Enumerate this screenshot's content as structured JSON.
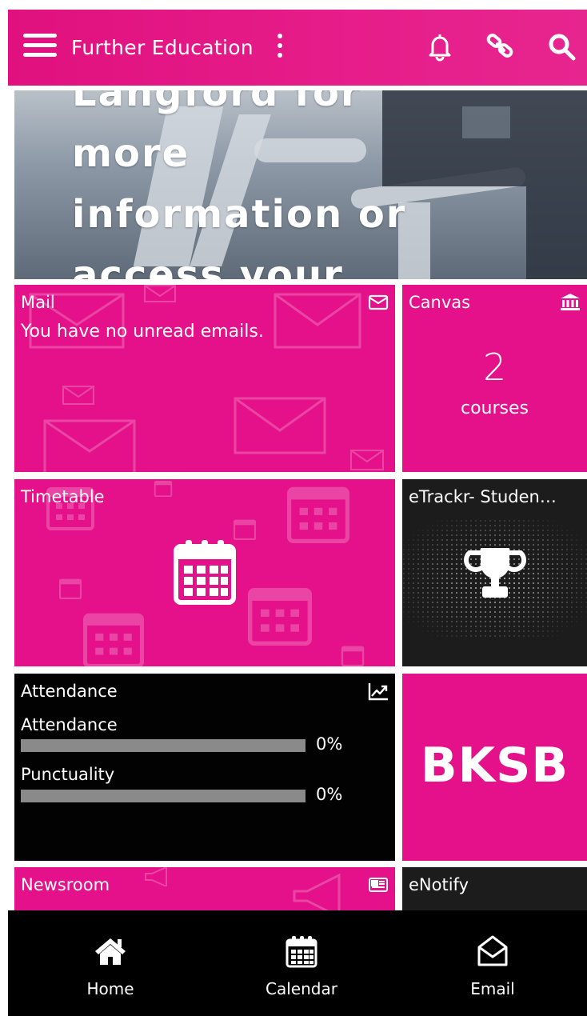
{
  "header": {
    "title": "Further Education",
    "icons": [
      "menu-icon",
      "more-vertical-icon",
      "bell-icon",
      "link-icon",
      "search-icon"
    ]
  },
  "banner": {
    "lines": [
      "Langford for",
      "more",
      "information or",
      "access your"
    ]
  },
  "tiles": {
    "mail": {
      "label": "Mail",
      "message": "You have no unread emails.",
      "icon": "envelope-icon"
    },
    "canvas": {
      "label": "Canvas",
      "count": "2",
      "unit": "courses",
      "icon": "bank-icon"
    },
    "timetable": {
      "label": "Timetable",
      "icon": "calendar-icon"
    },
    "etrackr": {
      "label": "eTrackr- Studen…",
      "icon": "trophy-icon"
    },
    "attendance": {
      "label": "Attendance",
      "icon": "trend-icon",
      "rows": [
        {
          "label": "Attendance",
          "value": 0,
          "display": "0%"
        },
        {
          "label": "Punctuality",
          "value": 0,
          "display": "0%"
        }
      ]
    },
    "bksb": {
      "text": "BKSB"
    },
    "newsroom": {
      "label": "Newsroom",
      "icon": "newspaper-icon"
    },
    "enotify": {
      "label": "eNotify"
    }
  },
  "bottom_nav": {
    "items": [
      {
        "label": "Home",
        "icon": "home-icon"
      },
      {
        "label": "Calendar",
        "icon": "calendar-icon"
      },
      {
        "label": "Email",
        "icon": "email-open-icon"
      }
    ]
  },
  "colors": {
    "brand_pink": "#e4118a",
    "header_pink": "#e61d8a",
    "tile_black": "#020202",
    "nav_black": "#000000"
  }
}
